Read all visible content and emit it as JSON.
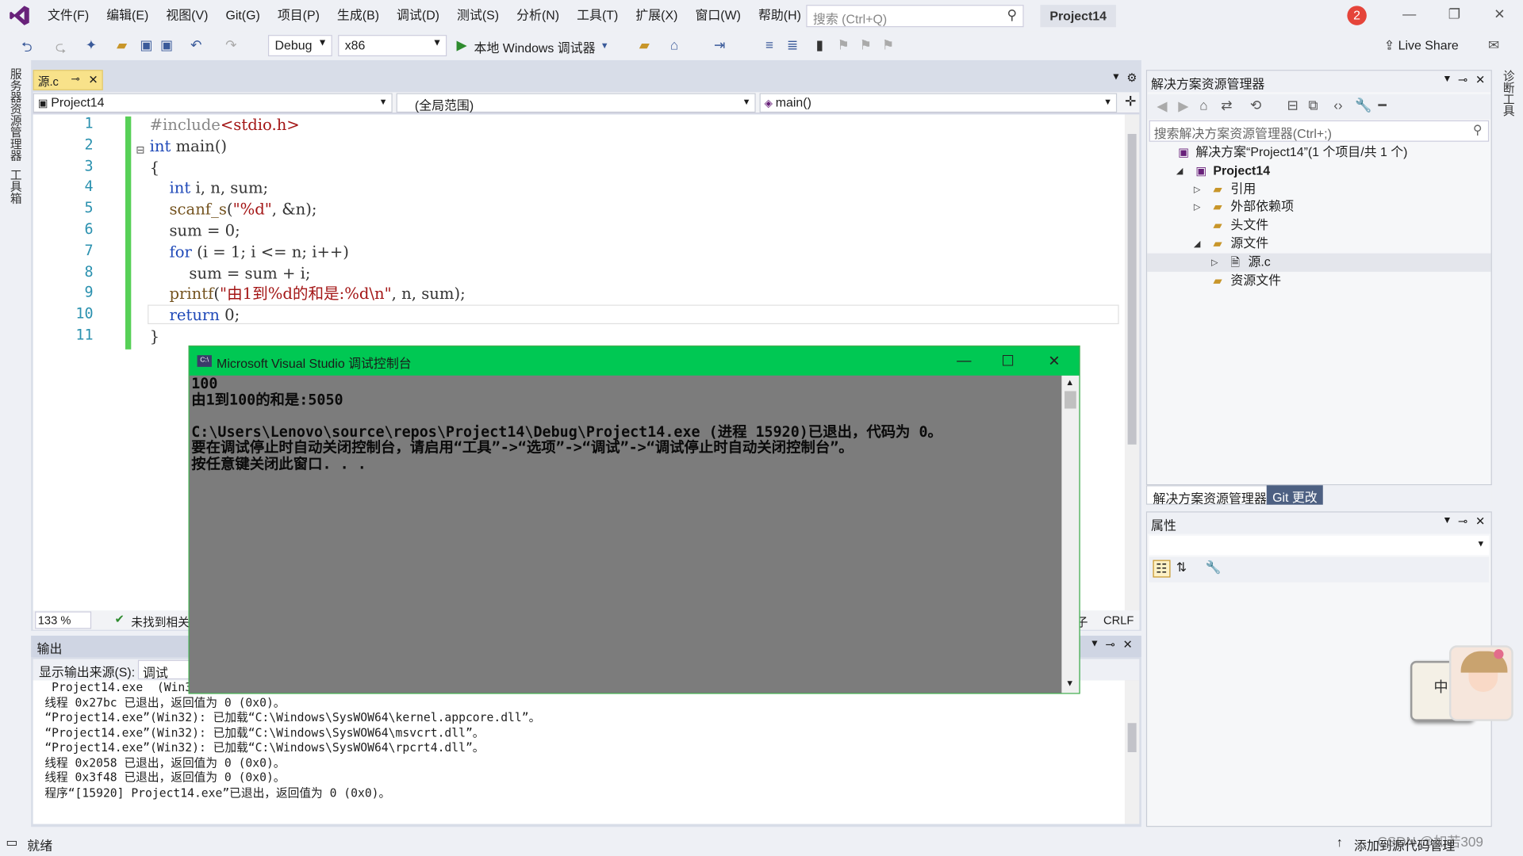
{
  "menu": [
    "文件(F)",
    "编辑(E)",
    "视图(V)",
    "Git(G)",
    "项目(P)",
    "生成(B)",
    "调试(D)",
    "测试(S)",
    "分析(N)",
    "工具(T)",
    "扩展(X)",
    "窗口(W)",
    "帮助(H)"
  ],
  "search": {
    "placeholder": "搜索 (Ctrl+Q)"
  },
  "project_title": "Project14",
  "notification_count": "2",
  "toolbar": {
    "config": "Debug",
    "platform": "x86",
    "run_label": "本地 Windows 调试器",
    "live_share": "Live Share"
  },
  "left_strip": [
    "服务器资源管理器",
    "工具箱"
  ],
  "right_strip": [
    "诊断工具"
  ],
  "editor": {
    "tab_name": "源.c",
    "nav_project": "Project14",
    "nav_scope": "(全局范围)",
    "nav_member": "main()",
    "line_numbers": [
      "1",
      "2",
      "3",
      "4",
      "5",
      "6",
      "7",
      "8",
      "9",
      "10",
      "11"
    ],
    "zoom": "133 %",
    "issues": "未找到相关",
    "line_ending": "CRLF",
    "encoding_hint": "子"
  },
  "console": {
    "title": "Microsoft Visual Studio 调试控制台",
    "icon_text": "C:\\",
    "lines": [
      "100",
      "由1到100的和是:5050",
      "",
      "C:\\Users\\Lenovo\\source\\repos\\Project14\\Debug\\Project14.exe (进程 15920)已退出，代码为 0。",
      "要在调试停止时自动关闭控制台，请启用“工具”->“选项”->“调试”->“调试停止时自动关闭控制台”。",
      "按任意键关闭此窗口. . ."
    ]
  },
  "output": {
    "title": "输出",
    "source_label": "显示输出来源(S):",
    "source_value": "调试",
    "lines": [
      " Project14.exe  (Win32",
      "线程 0x27bc 已退出，返回值为 0 (0x0)。",
      "“Project14.exe”(Win32): 已加载“C:\\Windows\\SysWOW64\\kernel.appcore.dll”。",
      "“Project14.exe”(Win32): 已加载“C:\\Windows\\SysWOW64\\msvcrt.dll”。",
      "“Project14.exe”(Win32): 已加载“C:\\Windows\\SysWOW64\\rpcrt4.dll”。",
      "线程 0x2058 已退出，返回值为 0 (0x0)。",
      "线程 0x3f48 已退出，返回值为 0 (0x0)。",
      "程序“[15920] Project14.exe”已退出，返回值为 0 (0x0)。"
    ]
  },
  "solution_explorer": {
    "title": "解决方案资源管理器",
    "search_placeholder": "搜索解决方案资源管理器(Ctrl+;)",
    "tree": [
      {
        "label": "解决方案“Project14”(1 个项目/共 1 个)",
        "level": 0,
        "expander": ""
      },
      {
        "label": "Project14",
        "level": 1,
        "expander": "◢"
      },
      {
        "label": "引用",
        "level": 2,
        "expander": "▷"
      },
      {
        "label": "外部依赖项",
        "level": 2,
        "expander": "▷"
      },
      {
        "label": "头文件",
        "level": 2,
        "expander": ""
      },
      {
        "label": "源文件",
        "level": 2,
        "expander": "◢"
      },
      {
        "label": "源.c",
        "level": 3,
        "expander": "▷"
      },
      {
        "label": "资源文件",
        "level": 2,
        "expander": ""
      }
    ],
    "tab_active": "解决方案资源管理器",
    "tab_git": "Git 更改"
  },
  "properties": {
    "title": "属性"
  },
  "status": {
    "ready": "就绪",
    "right_text": "添加到源代码管理",
    "watermark": "CSDN @如若309"
  },
  "ime": {
    "label": "中"
  },
  "colors": {
    "accent": "#68217a",
    "console_title": "#00c853",
    "status_bg": "#eef0f5"
  }
}
